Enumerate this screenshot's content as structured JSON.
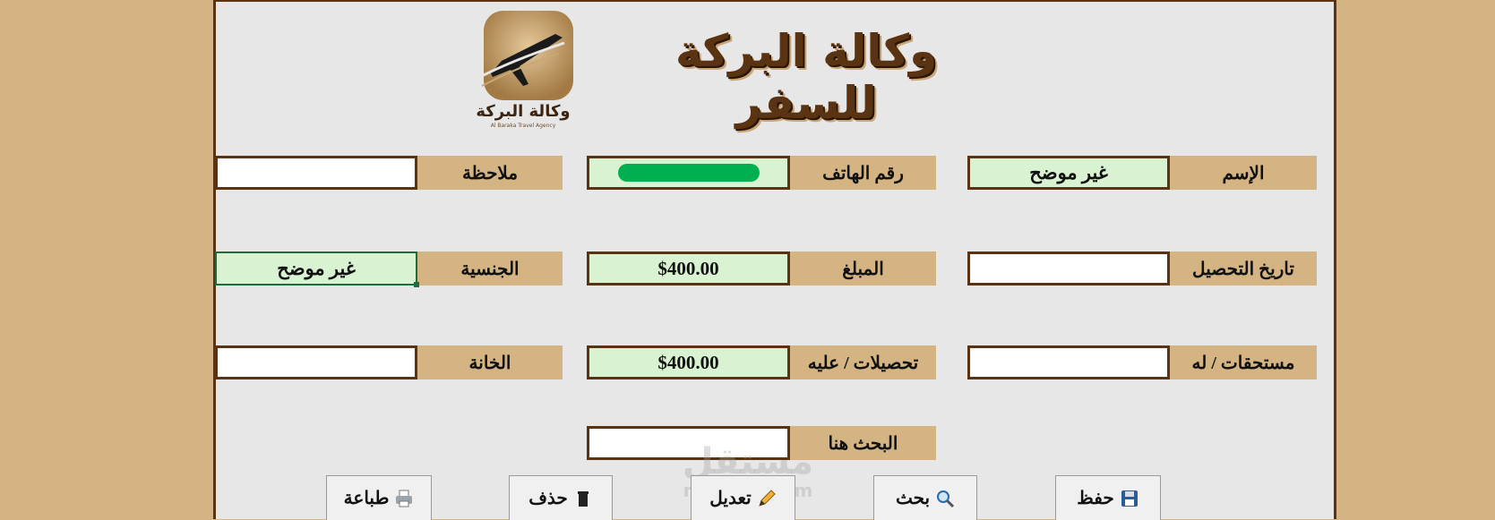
{
  "header": {
    "title": "وكالة البركة للسفر",
    "logo_text": "وكالة البركة",
    "logo_subtext": "Al Baraka Travel Agency"
  },
  "form": {
    "name": {
      "label": "الإسم",
      "value": "غير موضح"
    },
    "phone": {
      "label": "رقم الهاتف",
      "value": ""
    },
    "note": {
      "label": "ملاحظة",
      "value": ""
    },
    "collection_date": {
      "label": "تاريخ التحصيل",
      "value": ""
    },
    "amount": {
      "label": "المبلغ",
      "value": "$400.00"
    },
    "nationality": {
      "label": "الجنسية",
      "value": "غير موضح"
    },
    "dues": {
      "label": "مستحقات /  له",
      "value": ""
    },
    "collections": {
      "label": "تحصيلات / عليه",
      "value": "$400.00"
    },
    "slot": {
      "label": "الخانة",
      "value": ""
    },
    "search": {
      "label": "البحث هنا",
      "value": ""
    }
  },
  "buttons": {
    "save": "حفظ",
    "search": "بحث",
    "edit": "تعديل",
    "delete": "حذف",
    "print": "طباعة"
  },
  "watermark": {
    "text": "مستقل",
    "sub": "mostaql.com"
  },
  "colors": {
    "background": "#d4b483",
    "sheet": "#e7e7e7",
    "border": "#5a3412",
    "field_green": "#d9f3d2",
    "redaction": "#00b050"
  },
  "icons": {
    "save": "floppy-disk-icon",
    "search": "magnifier-icon",
    "edit": "pencil-icon",
    "delete": "trash-icon",
    "print": "printer-icon"
  }
}
